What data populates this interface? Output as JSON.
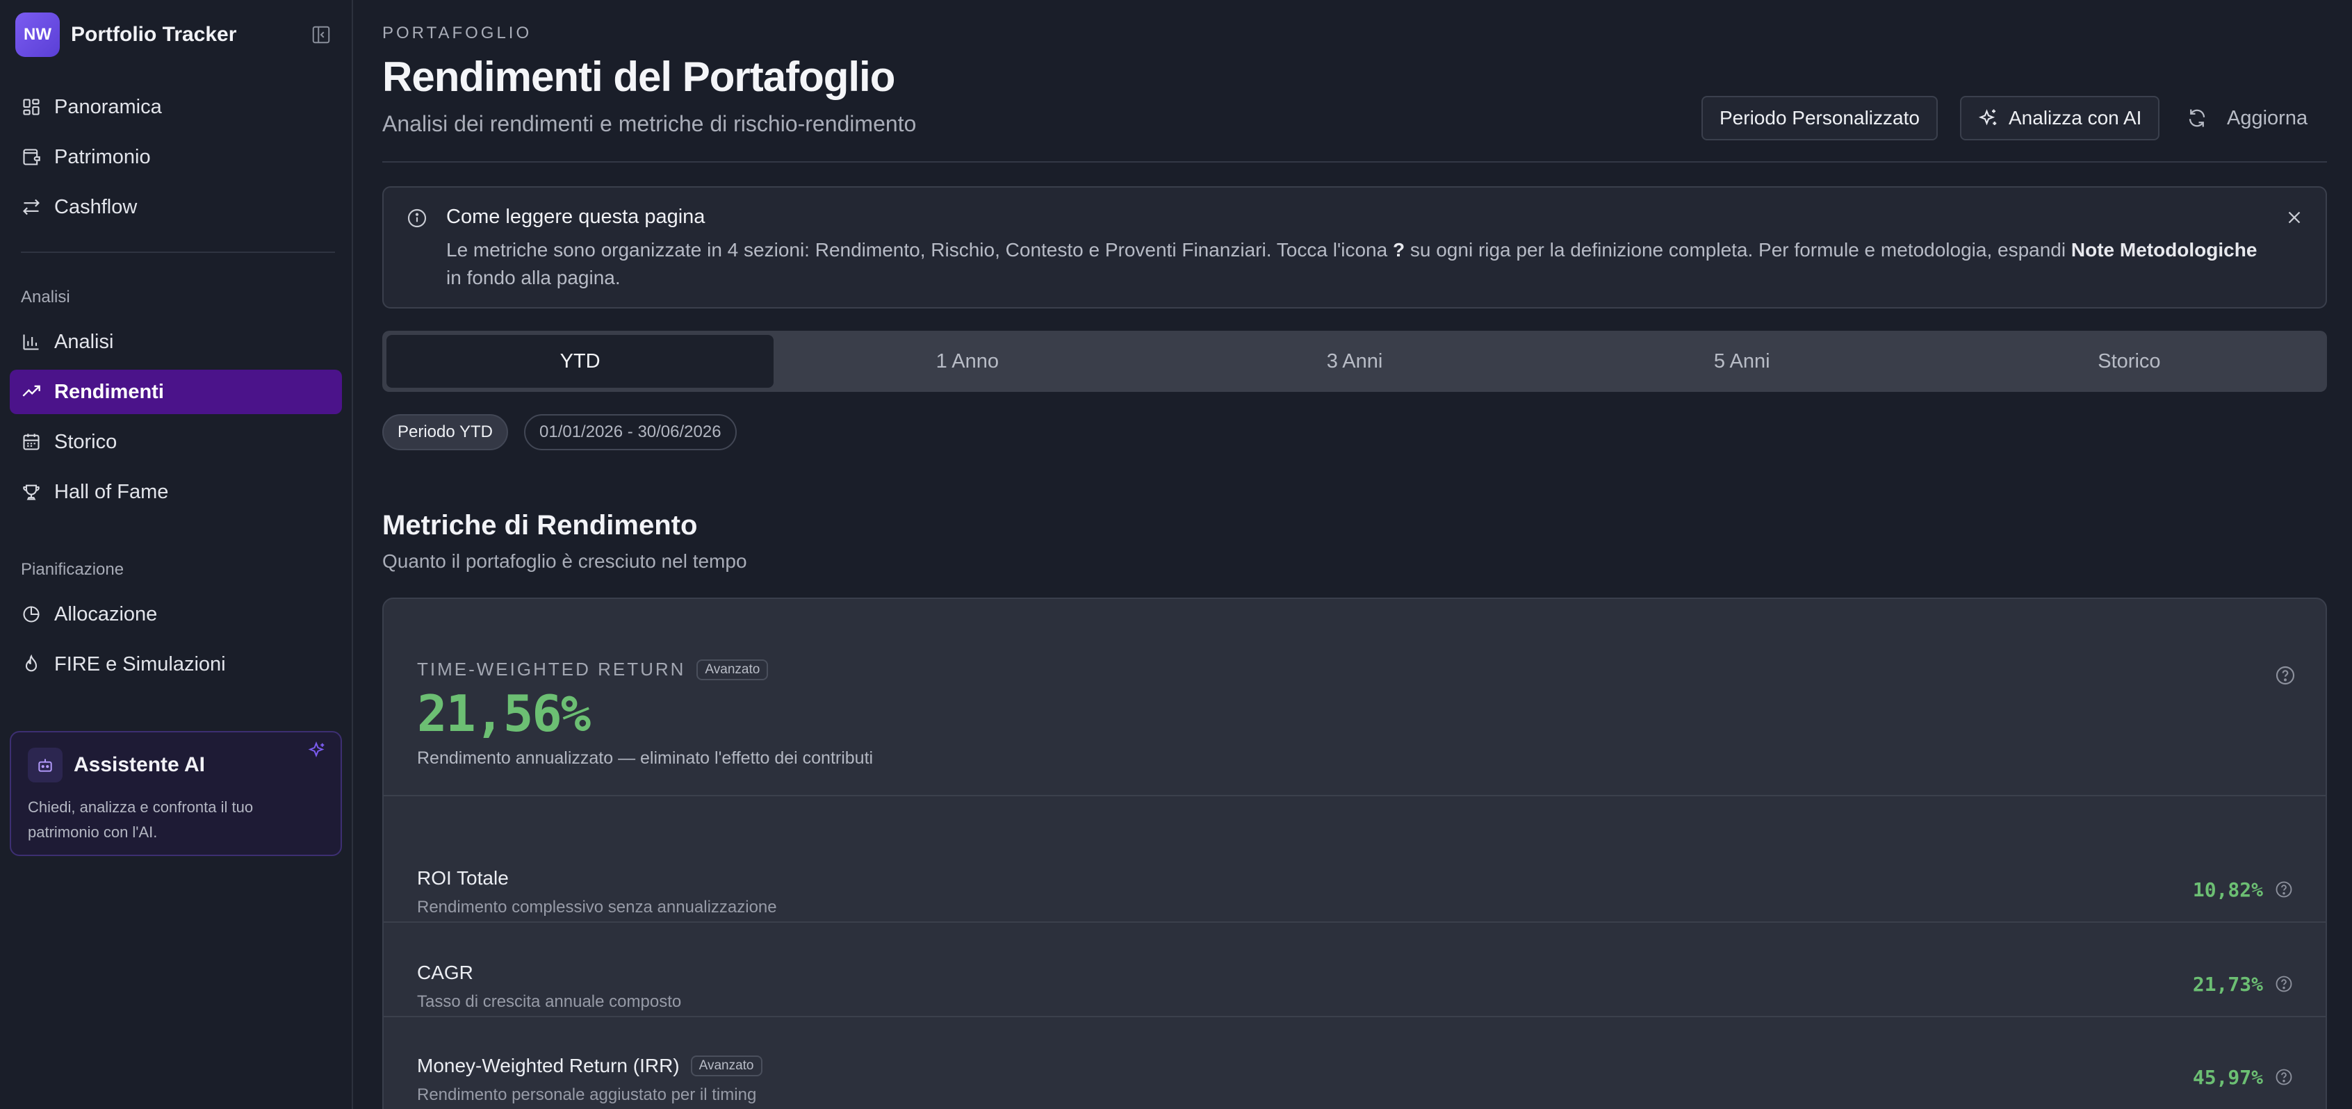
{
  "brand": {
    "initials": "NW",
    "name": "Portfolio Tracker"
  },
  "sidebar": {
    "items_main": [
      {
        "label": "Panoramica",
        "icon": "dashboard-icon"
      },
      {
        "label": "Patrimonio",
        "icon": "wallet-icon"
      },
      {
        "label": "Cashflow",
        "icon": "arrows-exchange-icon"
      }
    ],
    "section_analisi": "Analisi",
    "items_analisi": [
      {
        "label": "Analisi",
        "icon": "bar-chart-icon"
      },
      {
        "label": "Rendimenti",
        "icon": "trending-up-icon",
        "active": true
      },
      {
        "label": "Storico",
        "icon": "calendar-icon"
      },
      {
        "label": "Hall of Fame",
        "icon": "trophy-icon"
      }
    ],
    "section_pianificazione": "Pianificazione",
    "items_pianificazione": [
      {
        "label": "Allocazione",
        "icon": "pie-chart-icon"
      },
      {
        "label": "FIRE e Simulazioni",
        "icon": "flame-icon"
      }
    ],
    "ai_card": {
      "title": "Assistente AI",
      "description": "Chiedi, analizza e confronta il tuo patrimonio con l'AI."
    },
    "active_color": "#4b138a"
  },
  "header": {
    "eyebrow": "PORTAFOGLIO",
    "title": "Rendimenti del Portafoglio",
    "subtitle": "Analisi dei rendimenti e metriche di rischio-rendimento",
    "btn_custom_period": "Periodo Personalizzato",
    "btn_ai": "Analizza con AI",
    "btn_refresh": "Aggiorna"
  },
  "info": {
    "title": "Come leggere questa pagina",
    "text_pre": "Le metriche sono organizzate in 4 sezioni: Rendimento, Rischio, Contesto e Proventi Finanziari. Tocca l'icona ",
    "text_q": "?",
    "text_mid": " su ogni riga per la definizione completa. Per formule e metodologia, espandi ",
    "text_link": "Note Metodologiche",
    "text_post": " in fondo alla pagina."
  },
  "tabs": [
    "YTD",
    "1 Anno",
    "3 Anni",
    "5 Anni",
    "Storico"
  ],
  "active_tab": "YTD",
  "period": {
    "label": "Periodo YTD",
    "range": "01/01/2026 - 30/06/2026"
  },
  "section": {
    "title": "Metriche di Rendimento",
    "subtitle": "Quanto il portafoglio è cresciuto nel tempo"
  },
  "twr": {
    "label": "TIME-WEIGHTED RETURN",
    "badge": "Avanzato",
    "value": "21,56%",
    "description": "Rendimento annualizzato — eliminato l'effetto dei contributi"
  },
  "metrics": [
    {
      "name": "ROI Totale",
      "desc": "Rendimento complessivo senza annualizzazione",
      "value": "10,82%",
      "badge": ""
    },
    {
      "name": "CAGR",
      "desc": "Tasso di crescita annuale composto",
      "value": "21,73%",
      "badge": ""
    },
    {
      "name": "Money-Weighted Return (IRR)",
      "desc": "Rendimento personale aggiustato per il timing",
      "value": "45,97%",
      "badge": "Avanzato"
    }
  ],
  "colors": {
    "positive": "#6cbf73",
    "accent": "#7b5cf0"
  }
}
